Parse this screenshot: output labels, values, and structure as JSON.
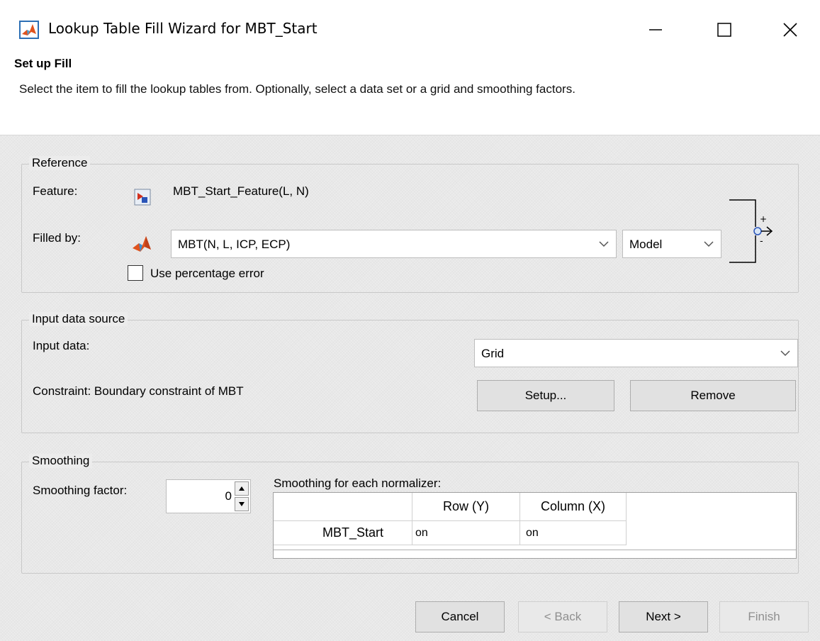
{
  "window": {
    "title": "Lookup Table Fill Wizard for MBT_Start",
    "icon": "matlab-icon"
  },
  "header": {
    "heading": "Set up Fill",
    "description": "Select the item to fill the lookup tables from. Optionally, select a data set or a grid and smoothing factors."
  },
  "reference": {
    "legend": "Reference",
    "feature_label": "Feature:",
    "feature_value": "MBT_Start_Feature(L, N)",
    "filled_by_label": "Filled by:",
    "filled_by_value": "MBT(N, L, ICP, ECP)",
    "type_value": "Model",
    "use_percentage_error_label": "Use percentage error",
    "use_percentage_error_checked": false
  },
  "input_source": {
    "legend": "Input data source",
    "input_data_label": "Input data:",
    "input_data_value": "Grid",
    "constraint_text": "Constraint: Boundary constraint of MBT",
    "setup_label": "Setup...",
    "remove_label": "Remove"
  },
  "smoothing": {
    "legend": "Smoothing",
    "factor_label": "Smoothing factor:",
    "factor_value": "0",
    "per_normalizer_label": "Smoothing for each normalizer:",
    "table": {
      "columns": [
        "Row (Y)",
        "Column (X)"
      ],
      "rows": [
        {
          "name": "MBT_Start",
          "values": [
            "on",
            "on"
          ]
        }
      ]
    }
  },
  "footer": {
    "cancel_label": "Cancel",
    "back_label": "< Back",
    "next_label": "Next >",
    "finish_label": "Finish"
  }
}
